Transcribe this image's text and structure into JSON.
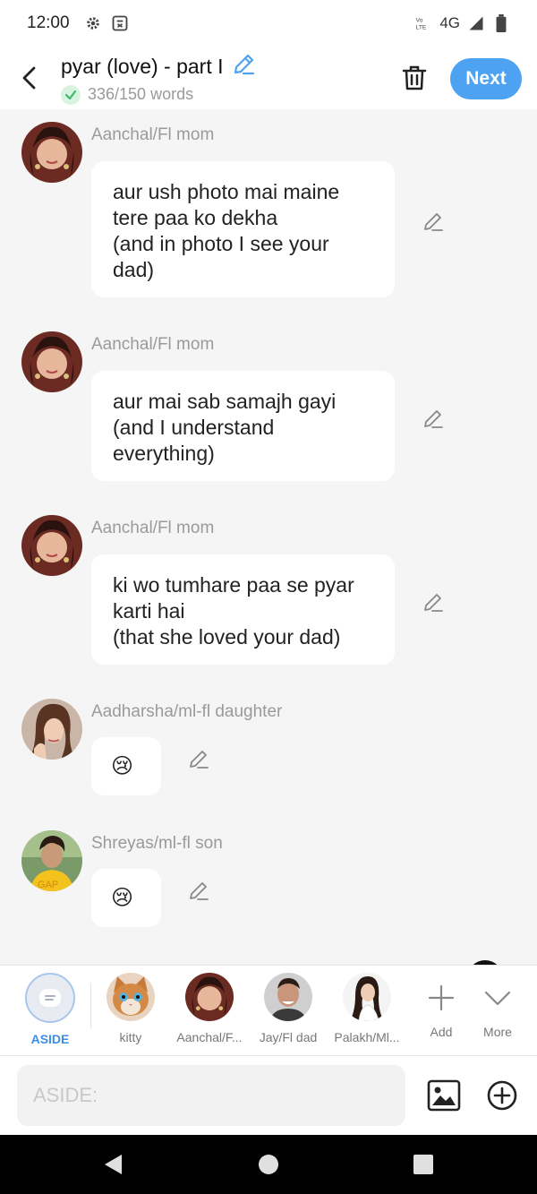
{
  "status_bar": {
    "time": "12:00",
    "network": "4G"
  },
  "header": {
    "title": "pyar (love) - part I",
    "word_count": "336/150 words",
    "next_label": "Next",
    "accent_color": "#4da3f2"
  },
  "messages": [
    {
      "sender": "Aanchal/Fl mom",
      "text": "aur ush photo mai maine\ntere paa ko dekha\n(and in photo I see your\ndad)"
    },
    {
      "sender": "Aanchal/Fl mom",
      "text": "aur mai sab samajh gayi\n(and I understand\neverything)"
    },
    {
      "sender": "Aanchal/Fl mom",
      "text": "ki wo tumhare paa se pyar\nkarti hai\n(that she loved your dad)"
    },
    {
      "sender": "Aadharsha/ml-fl daughter",
      "text": "😢"
    },
    {
      "sender": "Shreyas/ml-fl son",
      "text": "😢"
    }
  ],
  "characters": [
    {
      "label": "ASIDE",
      "active": true
    },
    {
      "label": "kitty"
    },
    {
      "label": "Aanchal/F..."
    },
    {
      "label": "Jay/Fl dad"
    },
    {
      "label": "Palakh/Ml..."
    }
  ],
  "strip_buttons": {
    "add_label": "Add",
    "more_label": "More"
  },
  "input": {
    "placeholder": "ASIDE:"
  }
}
